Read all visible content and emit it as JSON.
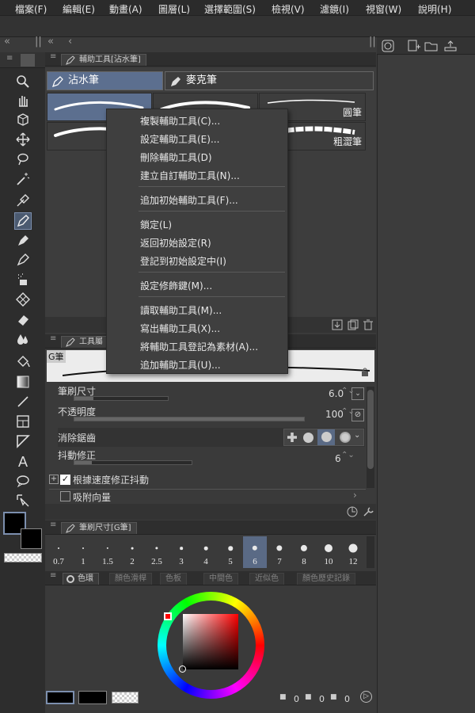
{
  "menubar": {
    "items": [
      "檔案(F)",
      "編輯(E)",
      "動畫(A)",
      "圖層(L)",
      "選擇範圍(S)",
      "檢視(V)",
      "濾鏡(I)",
      "視窗(W)",
      "說明(H)"
    ]
  },
  "subtool_panel": {
    "header": "輔助工具[沾水筆]",
    "tabs": [
      "沾水筆",
      "麥克筆"
    ],
    "brushes": [
      "",
      "",
      "圓筆",
      "",
      "粗",
      "粗澀筆"
    ]
  },
  "context_menu": {
    "items": [
      "複製輔助工具(C)...",
      "設定輔助工具(E)...",
      "刪除輔助工具(D)",
      "建立自訂輔助工具(N)...",
      "追加初始輔助工具(F)...",
      "鎖定(L)",
      "返回初始設定(R)",
      "登記到初始設定中(I)",
      "設定修飾鍵(M)...",
      "讀取輔助工具(M)...",
      "寫出輔助工具(X)...",
      "將輔助工具登記為素材(A)...",
      "追加輔助工具(U)..."
    ]
  },
  "tool_property": {
    "header": "工具屬",
    "preview_label": "G筆",
    "brush_size_label": "筆刷尺寸",
    "brush_size_value": "6.0",
    "brush_size_fraction": 0.2,
    "opacity_label": "不透明度",
    "opacity_value": "100",
    "opacity_fraction": 1.0,
    "antialias_label": "消除鋸齒",
    "stabilization_label": "抖動修正",
    "stabilization_value": "6",
    "stabilization_fraction": 0.15,
    "speed_label": "根據速度修正抖動",
    "snap_label": "吸附向量"
  },
  "brush_size_panel": {
    "header": "筆刷尺寸[G筆]",
    "sizes": [
      "0.7",
      "1",
      "1.5",
      "2",
      "2.5",
      "3",
      "4",
      "5",
      "6",
      "7",
      "8",
      "10",
      "12"
    ],
    "selected": "6"
  },
  "color_panel": {
    "tabs": [
      "色環",
      "顏色滑桿",
      "色板",
      "中間色",
      "近似色",
      "顏色歷史記錄"
    ],
    "footer_values": [
      "0",
      "0",
      "0"
    ]
  },
  "colors": {
    "main": "#000000",
    "sub": "#000000",
    "accent": "#5a6a85",
    "hue": "#ff0000"
  }
}
